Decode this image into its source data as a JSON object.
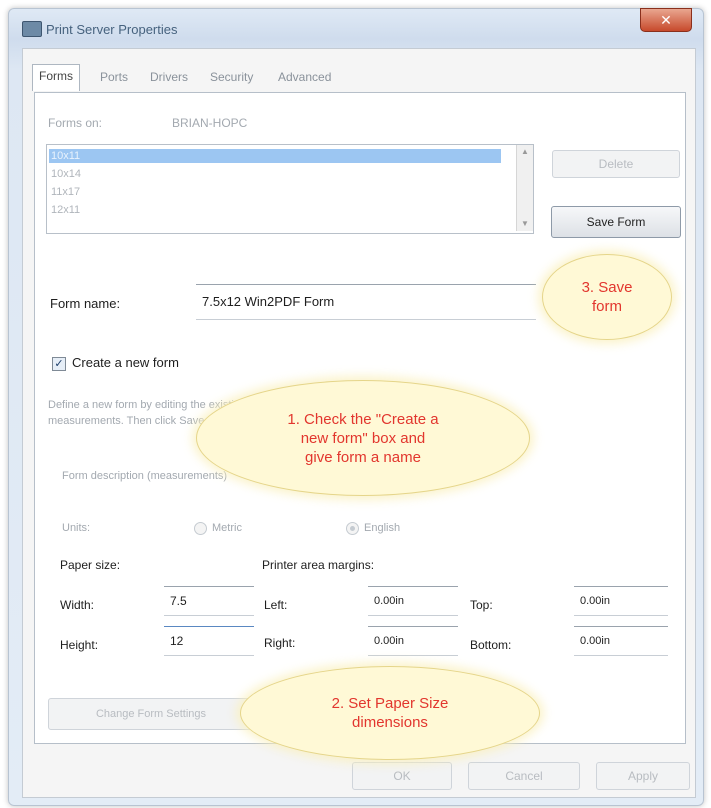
{
  "window": {
    "title": "Print Server Properties",
    "close_glyph": "✕"
  },
  "tabs": [
    "Forms",
    "Ports",
    "Drivers",
    "Security",
    "Advanced"
  ],
  "forms_on": {
    "label": "Forms on:",
    "value": "BRIAN-HOPC"
  },
  "forms_list": [
    "10x11",
    "10x14",
    "11x17",
    "12x11"
  ],
  "buttons": {
    "delete": "Delete",
    "save_form": "Save Form",
    "change_units": "Change Form Settings",
    "ok": "OK",
    "cancel": "Cancel",
    "apply": "Apply"
  },
  "form_name": {
    "label": "Form name:",
    "value": "7.5x12 Win2PDF Form"
  },
  "create_new": {
    "label": "Create a new form",
    "checked": true
  },
  "description": {
    "line1": "Define a new form by editing the existing name and",
    "line2": "measurements. Then click Save Form."
  },
  "form_description_group": "Form description (measurements)",
  "units": {
    "label": "Units:",
    "metric": "Metric",
    "english": "English",
    "selected": "English"
  },
  "paper_size": {
    "heading": "Paper size:",
    "width_label": "Width:",
    "width_value": "7.5",
    "height_label": "Height:",
    "height_value": "12"
  },
  "margins": {
    "heading": "Printer area margins:",
    "left_label": "Left:",
    "left_value": "0.00in",
    "right_label": "Right:",
    "right_value": "0.00in",
    "top_label": "Top:",
    "top_value": "0.00in",
    "bottom_label": "Bottom:",
    "bottom_value": "0.00in"
  },
  "callouts": {
    "step1": "1. Check the \"Create a\nnew form\" box and\ngive form a name",
    "step2": "2. Set Paper Size\ndimensions",
    "step3": "3. Save\nform"
  },
  "colors": {
    "callout_text": "#e2362e",
    "callout_fill": "#fff9d6"
  }
}
